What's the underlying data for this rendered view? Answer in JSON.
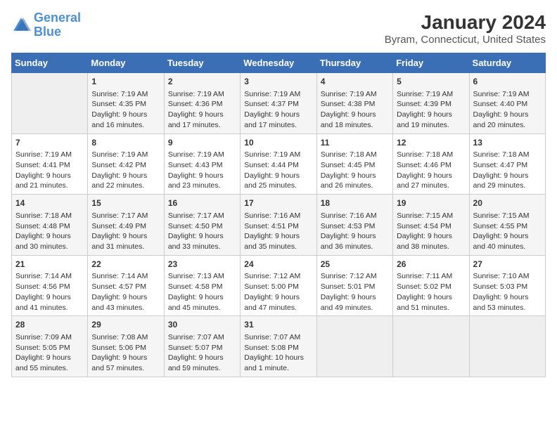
{
  "header": {
    "logo_line1": "General",
    "logo_line2": "Blue",
    "title": "January 2024",
    "subtitle": "Byram, Connecticut, United States"
  },
  "days_of_week": [
    "Sunday",
    "Monday",
    "Tuesday",
    "Wednesday",
    "Thursday",
    "Friday",
    "Saturday"
  ],
  "weeks": [
    [
      {
        "day": "",
        "info": ""
      },
      {
        "day": "1",
        "info": "Sunrise: 7:19 AM\nSunset: 4:35 PM\nDaylight: 9 hours\nand 16 minutes."
      },
      {
        "day": "2",
        "info": "Sunrise: 7:19 AM\nSunset: 4:36 PM\nDaylight: 9 hours\nand 17 minutes."
      },
      {
        "day": "3",
        "info": "Sunrise: 7:19 AM\nSunset: 4:37 PM\nDaylight: 9 hours\nand 17 minutes."
      },
      {
        "day": "4",
        "info": "Sunrise: 7:19 AM\nSunset: 4:38 PM\nDaylight: 9 hours\nand 18 minutes."
      },
      {
        "day": "5",
        "info": "Sunrise: 7:19 AM\nSunset: 4:39 PM\nDaylight: 9 hours\nand 19 minutes."
      },
      {
        "day": "6",
        "info": "Sunrise: 7:19 AM\nSunset: 4:40 PM\nDaylight: 9 hours\nand 20 minutes."
      }
    ],
    [
      {
        "day": "7",
        "info": "Sunrise: 7:19 AM\nSunset: 4:41 PM\nDaylight: 9 hours\nand 21 minutes."
      },
      {
        "day": "8",
        "info": "Sunrise: 7:19 AM\nSunset: 4:42 PM\nDaylight: 9 hours\nand 22 minutes."
      },
      {
        "day": "9",
        "info": "Sunrise: 7:19 AM\nSunset: 4:43 PM\nDaylight: 9 hours\nand 23 minutes."
      },
      {
        "day": "10",
        "info": "Sunrise: 7:19 AM\nSunset: 4:44 PM\nDaylight: 9 hours\nand 25 minutes."
      },
      {
        "day": "11",
        "info": "Sunrise: 7:18 AM\nSunset: 4:45 PM\nDaylight: 9 hours\nand 26 minutes."
      },
      {
        "day": "12",
        "info": "Sunrise: 7:18 AM\nSunset: 4:46 PM\nDaylight: 9 hours\nand 27 minutes."
      },
      {
        "day": "13",
        "info": "Sunrise: 7:18 AM\nSunset: 4:47 PM\nDaylight: 9 hours\nand 29 minutes."
      }
    ],
    [
      {
        "day": "14",
        "info": "Sunrise: 7:18 AM\nSunset: 4:48 PM\nDaylight: 9 hours\nand 30 minutes."
      },
      {
        "day": "15",
        "info": "Sunrise: 7:17 AM\nSunset: 4:49 PM\nDaylight: 9 hours\nand 31 minutes."
      },
      {
        "day": "16",
        "info": "Sunrise: 7:17 AM\nSunset: 4:50 PM\nDaylight: 9 hours\nand 33 minutes."
      },
      {
        "day": "17",
        "info": "Sunrise: 7:16 AM\nSunset: 4:51 PM\nDaylight: 9 hours\nand 35 minutes."
      },
      {
        "day": "18",
        "info": "Sunrise: 7:16 AM\nSunset: 4:53 PM\nDaylight: 9 hours\nand 36 minutes."
      },
      {
        "day": "19",
        "info": "Sunrise: 7:15 AM\nSunset: 4:54 PM\nDaylight: 9 hours\nand 38 minutes."
      },
      {
        "day": "20",
        "info": "Sunrise: 7:15 AM\nSunset: 4:55 PM\nDaylight: 9 hours\nand 40 minutes."
      }
    ],
    [
      {
        "day": "21",
        "info": "Sunrise: 7:14 AM\nSunset: 4:56 PM\nDaylight: 9 hours\nand 41 minutes."
      },
      {
        "day": "22",
        "info": "Sunrise: 7:14 AM\nSunset: 4:57 PM\nDaylight: 9 hours\nand 43 minutes."
      },
      {
        "day": "23",
        "info": "Sunrise: 7:13 AM\nSunset: 4:58 PM\nDaylight: 9 hours\nand 45 minutes."
      },
      {
        "day": "24",
        "info": "Sunrise: 7:12 AM\nSunset: 5:00 PM\nDaylight: 9 hours\nand 47 minutes."
      },
      {
        "day": "25",
        "info": "Sunrise: 7:12 AM\nSunset: 5:01 PM\nDaylight: 9 hours\nand 49 minutes."
      },
      {
        "day": "26",
        "info": "Sunrise: 7:11 AM\nSunset: 5:02 PM\nDaylight: 9 hours\nand 51 minutes."
      },
      {
        "day": "27",
        "info": "Sunrise: 7:10 AM\nSunset: 5:03 PM\nDaylight: 9 hours\nand 53 minutes."
      }
    ],
    [
      {
        "day": "28",
        "info": "Sunrise: 7:09 AM\nSunset: 5:05 PM\nDaylight: 9 hours\nand 55 minutes."
      },
      {
        "day": "29",
        "info": "Sunrise: 7:08 AM\nSunset: 5:06 PM\nDaylight: 9 hours\nand 57 minutes."
      },
      {
        "day": "30",
        "info": "Sunrise: 7:07 AM\nSunset: 5:07 PM\nDaylight: 9 hours\nand 59 minutes."
      },
      {
        "day": "31",
        "info": "Sunrise: 7:07 AM\nSunset: 5:08 PM\nDaylight: 10 hours\nand 1 minute."
      },
      {
        "day": "",
        "info": ""
      },
      {
        "day": "",
        "info": ""
      },
      {
        "day": "",
        "info": ""
      }
    ]
  ]
}
